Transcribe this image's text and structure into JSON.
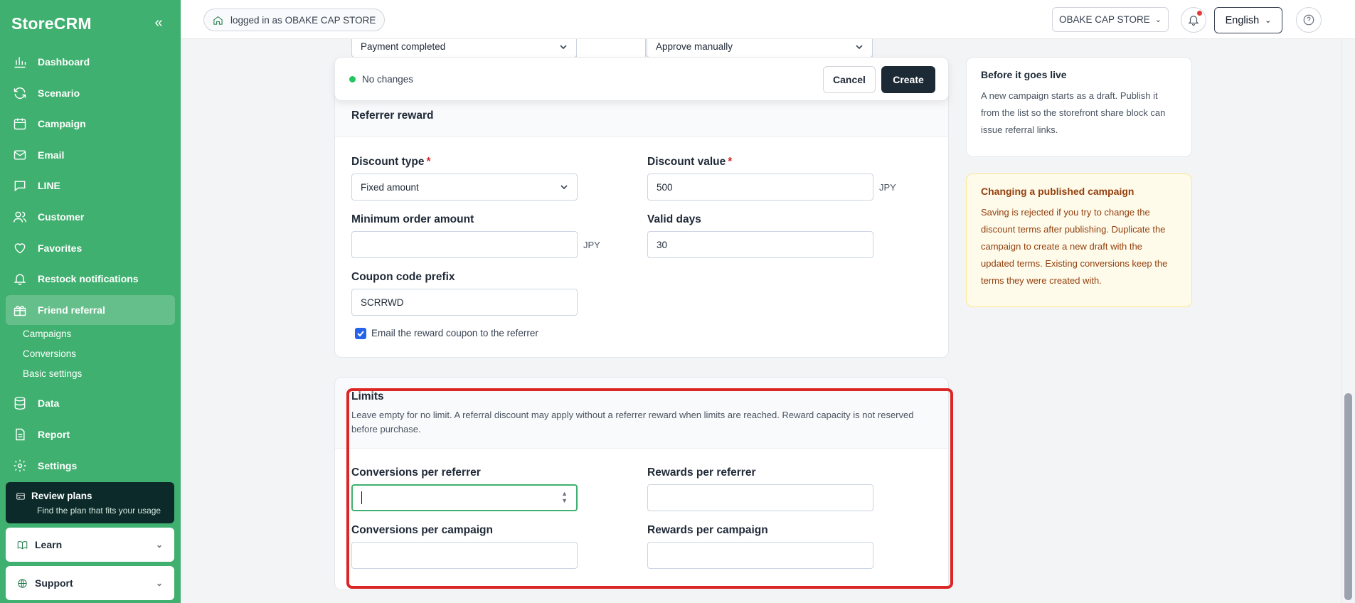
{
  "sidebar": {
    "brand": "StoreCRM",
    "collapse_icon": "double-chevron-left-icon",
    "items": [
      {
        "label": "Dashboard",
        "icon": "bar-chart-icon"
      },
      {
        "label": "Scenario",
        "icon": "refresh-icon"
      },
      {
        "label": "Campaign",
        "icon": "calendar-icon"
      },
      {
        "label": "Email",
        "icon": "mail-icon"
      },
      {
        "label": "LINE",
        "icon": "chat-icon"
      },
      {
        "label": "Customer",
        "icon": "users-icon"
      },
      {
        "label": "Favorites",
        "icon": "heart-icon"
      },
      {
        "label": "Restock notifications",
        "icon": "bell-icon"
      },
      {
        "label": "Friend referral",
        "icon": "gift-icon"
      }
    ],
    "subitems": [
      "Campaigns",
      "Conversions",
      "Basic settings"
    ],
    "items_after": [
      {
        "label": "Data",
        "icon": "database-icon"
      },
      {
        "label": "Report",
        "icon": "document-icon"
      },
      {
        "label": "Settings",
        "icon": "gear-icon"
      }
    ],
    "review": {
      "title": "Review plans",
      "subtitle": "Find the plan that fits your usage"
    },
    "learn": "Learn",
    "support": "Support"
  },
  "topbar": {
    "login_text": "logged in as",
    "store_name": "OBAKE CAP STORE",
    "store_selector": "OBAKE CAP STORE",
    "language": "English"
  },
  "partial": {
    "trigger_value": "Payment completed",
    "approval_value": "Approve manually"
  },
  "sticky": {
    "status": "No changes",
    "cancel": "Cancel",
    "create": "Create"
  },
  "referrer_reward": {
    "title": "Referrer reward",
    "discount_type_label": "Discount type",
    "discount_type_value": "Fixed amount",
    "discount_value_label": "Discount value",
    "discount_value": "500",
    "discount_unit": "JPY",
    "min_order_label": "Minimum order amount",
    "min_order_value": "",
    "min_order_unit": "JPY",
    "valid_days_label": "Valid days",
    "valid_days_value": "30",
    "coupon_prefix_label": "Coupon code prefix",
    "coupon_prefix_value": "SCRRWD",
    "email_checkbox_label": "Email the reward coupon to the referrer",
    "email_checked": true
  },
  "limits": {
    "title": "Limits",
    "description": "Leave empty for no limit. A referral discount may apply without a referrer reward when limits are reached. Reward capacity is not reserved before purchase.",
    "conv_per_referrer_label": "Conversions per referrer",
    "conv_per_referrer_value": "",
    "rewards_per_referrer_label": "Rewards per referrer",
    "rewards_per_referrer_value": "",
    "conv_per_campaign_label": "Conversions per campaign",
    "conv_per_campaign_value": "",
    "rewards_per_campaign_label": "Rewards per campaign",
    "rewards_per_campaign_value": ""
  },
  "info": {
    "live_title": "Before it goes live",
    "live_text": "A new campaign starts as a draft. Publish it from the list so the storefront share block can issue referral links.",
    "published_title": "Changing a published campaign",
    "published_text": "Saving is rejected if you try to change the discount terms after publishing. Duplicate the campaign to create a new draft with the updated terms. Existing conversions keep the terms they were created with."
  },
  "colors": {
    "sidebar": "#3fb06f",
    "primary_button": "#1c2a36",
    "highlight": "#dc2626",
    "warning_bg": "#fffbeb"
  }
}
